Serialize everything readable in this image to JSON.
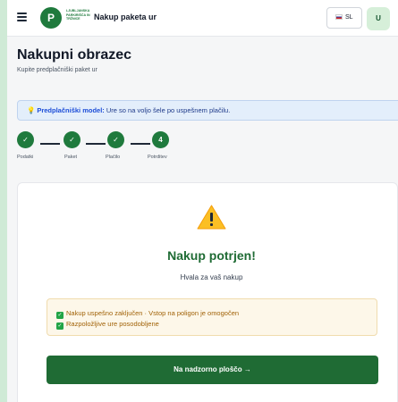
{
  "header": {
    "logo_letter": "P",
    "logo_text": "LJUBLJANSKA PARKIRIŠČA IN TRŽNICE",
    "title": "Nakup paketa ur",
    "language": "SL",
    "user_initial": "U"
  },
  "page": {
    "title": "Nakupni obrazec",
    "subtitle": "Kupite predplačniški paket ur"
  },
  "info": {
    "label": "Predplačniški model:",
    "text": " Ure so na voljo šele po uspešnem plačilu."
  },
  "stepper": {
    "steps": [
      {
        "label": "Podatki",
        "mark": "✓",
        "done": true
      },
      {
        "label": "Paket",
        "mark": "✓",
        "done": true
      },
      {
        "label": "Plačilo",
        "mark": "✓",
        "done": true
      },
      {
        "label": "Potrditev",
        "mark": "4",
        "done": false
      }
    ]
  },
  "card": {
    "icon": "warning-icon",
    "title": "Nakup potrjen!",
    "subtitle": "Hvala za vaš nakup",
    "notices": [
      "Nakup uspešno zaključen · Vstop na poligon je omogočen",
      "Razpoložljive ure posodobljene"
    ],
    "cta_label": "Na nadzorno ploščo →"
  },
  "colors": {
    "primary": "#1f6b34",
    "step_green": "#1f7a3d",
    "info_bg": "#e3eefb",
    "notice_bg": "#fdf7e9",
    "notice_text": "#a16207"
  }
}
